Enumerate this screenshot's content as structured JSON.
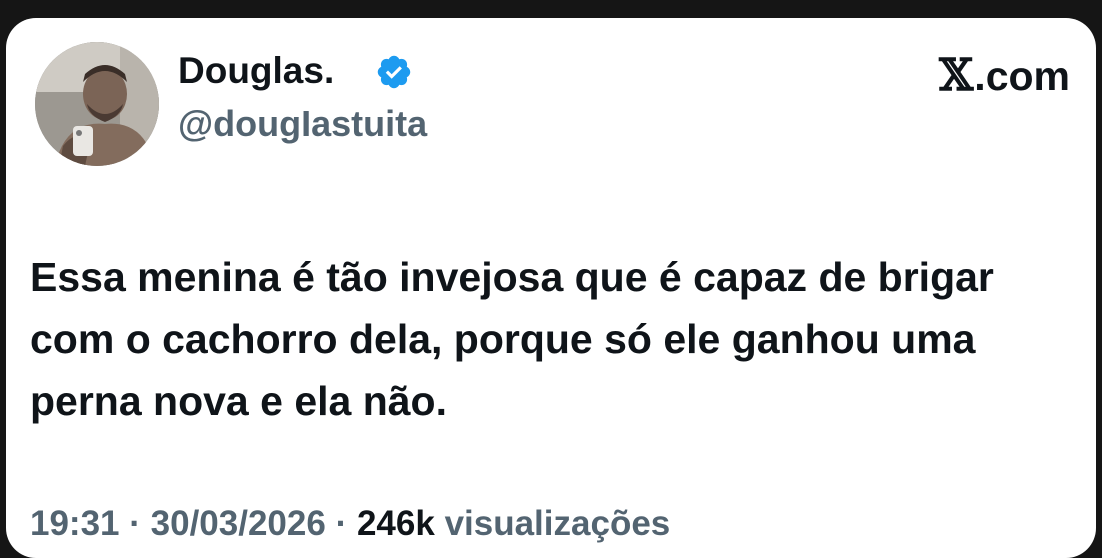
{
  "tweet": {
    "display_name": "Douglas.",
    "handle": "@dougIastuita",
    "verified_icon": "verified-badge-icon",
    "brand": "X.com",
    "text": "Essa menina é tão invejosa que é capaz de brigar com o cachorro dela, porque só ele ganhou uma perna nova e ela não.",
    "time": "19:31",
    "separator": "·",
    "date": "30/03/2026",
    "views_count": "246k",
    "views_label": "visualizações"
  },
  "colors": {
    "text_primary": "#0f1419",
    "text_secondary": "#536471",
    "verified_blue": "#1d9bf0",
    "background": "#151515",
    "card": "#ffffff"
  }
}
